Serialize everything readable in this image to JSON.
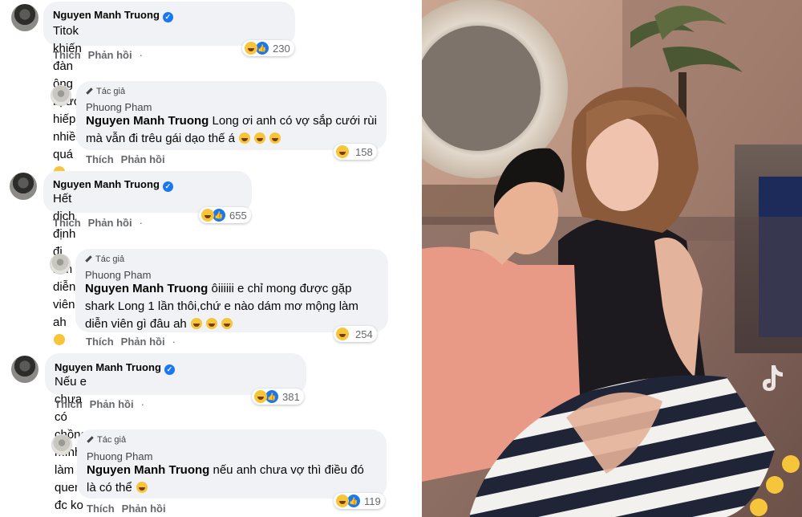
{
  "comments": [
    {
      "kind": "main",
      "name": "Nguyen Manh Truong",
      "text": "Titok khiến đàn ông bị ức hiếp nhiều quá",
      "actions": [
        "Thích",
        "Phản hồi",
        "·"
      ],
      "reactions": "230"
    },
    {
      "kind": "reply",
      "tag": "Tác giả",
      "name": "Phuong Pham",
      "mention": "Nguyen Manh Truong",
      "text": " Long ơi anh có vợ sắp cưới rùi mà vẫn đi trêu gái dạo thế á",
      "actions": [
        "Thích",
        "Phản hồi"
      ],
      "reactions": "158"
    },
    {
      "kind": "main",
      "name": "Nguyen Manh Truong",
      "text": "Hết dịch định đi làm diễn viên ah",
      "actions": [
        "Thích",
        "Phản hồi",
        "·"
      ],
      "reactions": "655"
    },
    {
      "kind": "reply",
      "tag": "Tác giả",
      "name": "Phuong Pham",
      "mention": "Nguyen Manh Truong",
      "text": " ôiiiiii e chỉ mong được gặp shark Long 1 lần thôi,chứ e nào dám mơ mộng làm diễn viên gì đâu ah",
      "actions": [
        "Thích",
        "Phản hồi",
        "·"
      ],
      "reactions": "254"
    },
    {
      "kind": "main",
      "name": "Nguyen Manh Truong",
      "text": "Nếu e chưa có chồng mình làm quen đc ko",
      "actions": [
        "Thích",
        "Phản hồi",
        "·"
      ],
      "reactions": "381"
    },
    {
      "kind": "reply",
      "tag": "Tác giả",
      "name": "Phuong Pham",
      "mention": "Nguyen Manh Truong",
      "text": " nếu anh chưa vợ thì điều đó là có thể",
      "actions": [
        "Thích",
        "Phản hồi"
      ],
      "reactions": "119"
    }
  ],
  "video": {
    "watermark": "tiktok-logo-icon"
  }
}
